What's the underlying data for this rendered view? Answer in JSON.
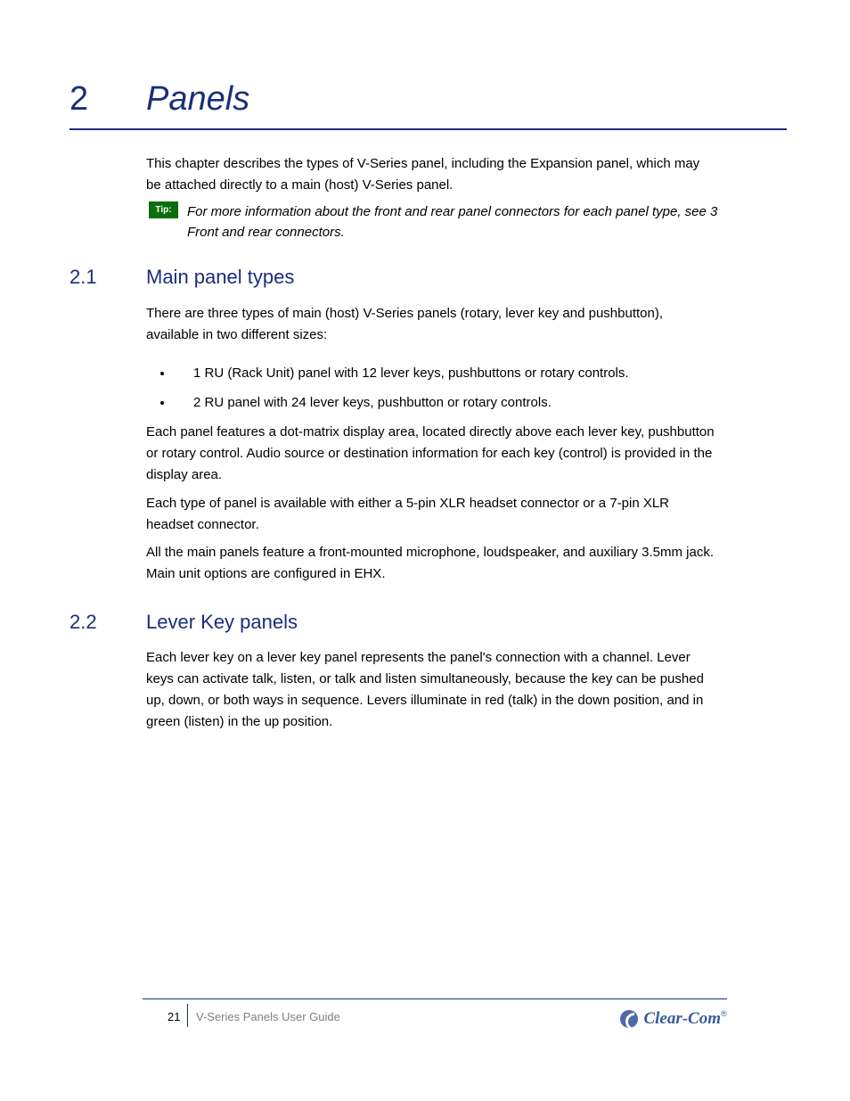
{
  "chapter": {
    "number": "2",
    "title": "Panels"
  },
  "intro": "This chapter describes the types of V-Series panel, including the Expansion panel, which may be attached directly to a main (host) V-Series panel.",
  "tip": {
    "label": "Tip:",
    "text": "For more information about the front and rear panel connectors for each panel type, see 3 Front and rear connectors."
  },
  "section1": {
    "number": "2.1",
    "title": "Main panel types",
    "para1": "There are three types of main (host) V-Series panels (rotary, lever key and pushbutton), available in two different sizes:",
    "bullet1": "1 RU (Rack Unit) panel with 12 lever keys, pushbuttons or rotary controls.",
    "bullet2": "2 RU panel with 24 lever keys, pushbutton or rotary controls.",
    "para2": "Each panel features a dot-matrix display area, located directly above each lever key, pushbutton or rotary control. Audio source or destination information for each key (control) is provided in the display area.",
    "para3": "Each type of panel is available with either a 5-pin XLR headset connector or a 7-pin XLR headset connector.",
    "para4": "All the main panels feature a front-mounted microphone, loudspeaker, and auxiliary 3.5mm jack. Main unit options are configured in EHX."
  },
  "section2": {
    "number": "2.2",
    "title": "Lever Key panels",
    "para5": "Each lever key on a lever key panel represents the panel's connection with a channel. Lever keys can activate talk, listen, or talk and listen simultaneously, because the key can be pushed up, down, or both ways in sequence. Levers illuminate in red (talk) in the down position, and in green (listen) in the up position."
  },
  "footer": {
    "page_number": "21",
    "doc_title": "V-Series Panels User Guide",
    "brand": "Clear-Com"
  }
}
